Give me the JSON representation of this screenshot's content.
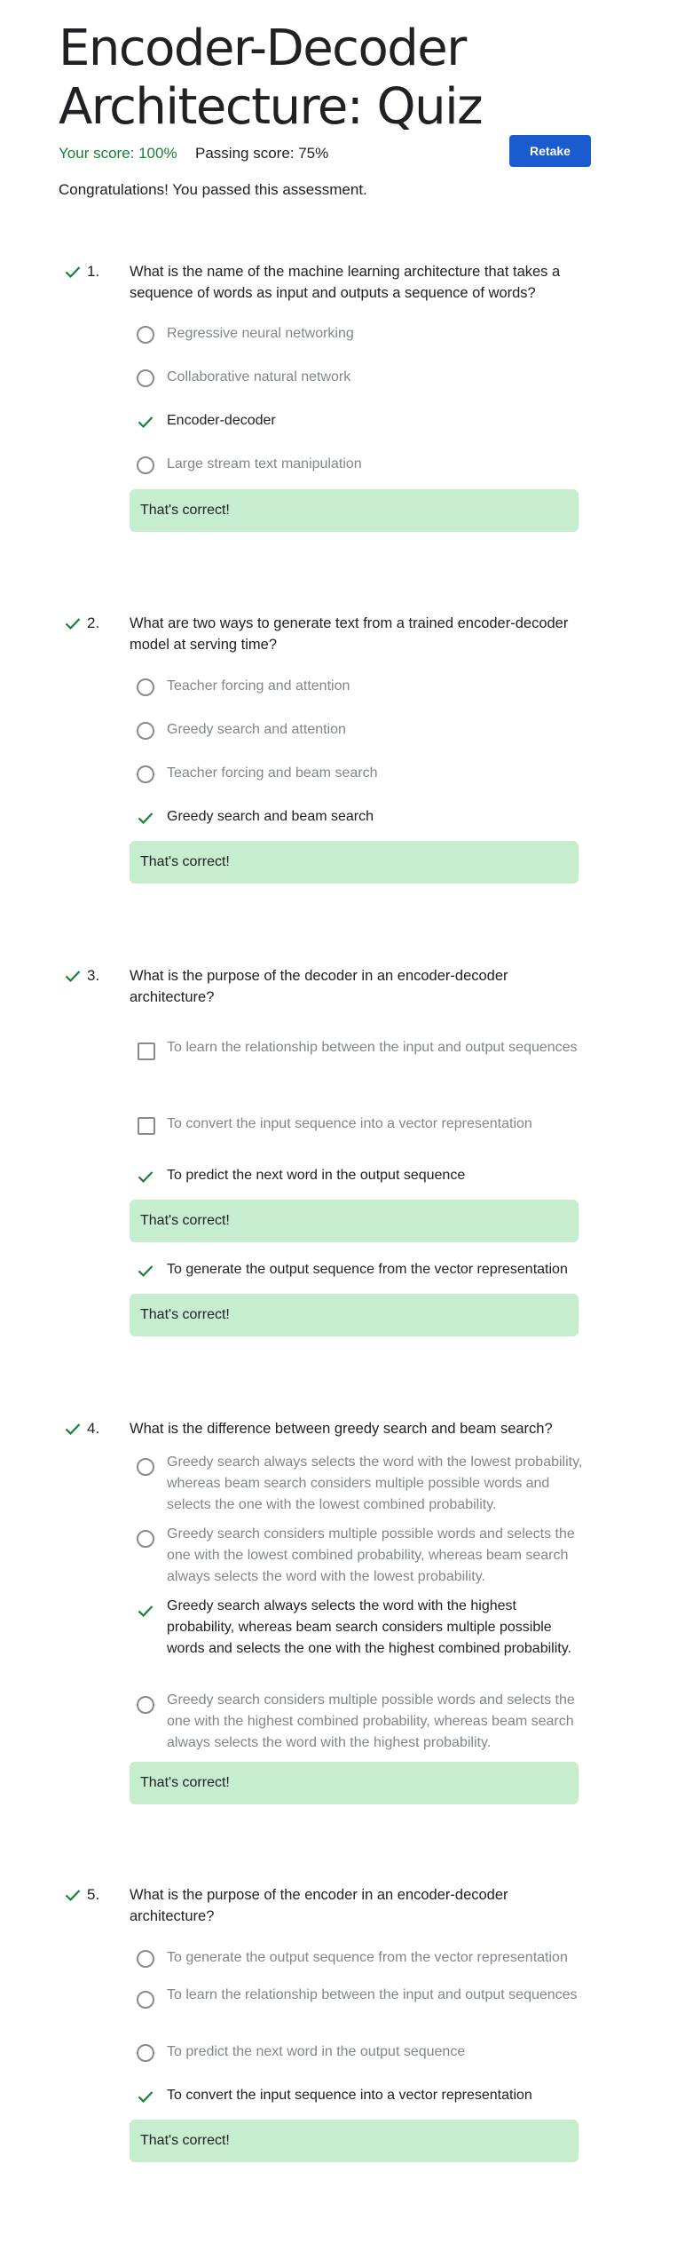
{
  "page": {
    "title_line1": "Encoder-Decoder",
    "title_line2": "Architecture: Quiz",
    "score_label": "Your score: 100%",
    "passing_label": "Passing score: 75%",
    "retake_label": "Retake",
    "congrats": "Congratulations! You passed this assessment."
  },
  "colors": {
    "accent_button": "#1a5cd0",
    "correct_green": "#188038",
    "feedback_bg": "#c7edcf"
  },
  "questions": [
    {
      "number": "1.",
      "text": "What is the name of the machine learning architecture that takes a sequence of words as input and outputs a sequence of words?",
      "options": [
        {
          "label": "Regressive neural networking",
          "mark": "radio"
        },
        {
          "label": "Collaborative natural network",
          "mark": "radio"
        },
        {
          "label": "Encoder-decoder",
          "mark": "check"
        },
        {
          "label": "Large stream text manipulation",
          "mark": "radio"
        }
      ],
      "feedback": [
        "That's correct!"
      ]
    },
    {
      "number": "2.",
      "text": "What are two ways to generate text from a trained encoder-decoder model at serving time?",
      "options": [
        {
          "label": "Teacher forcing and attention",
          "mark": "radio"
        },
        {
          "label": "Greedy search and attention",
          "mark": "radio"
        },
        {
          "label": "Teacher forcing and beam search",
          "mark": "radio"
        },
        {
          "label": "Greedy search and beam search",
          "mark": "check"
        }
      ],
      "feedback": [
        "That's correct!"
      ]
    },
    {
      "number": "3.",
      "text": "What is the purpose of the decoder in an encoder-decoder architecture?",
      "options": [
        {
          "label": "To learn the relationship between the input and output sequences",
          "mark": "checkbox"
        },
        {
          "label": "To convert the input sequence into a vector representation",
          "mark": "checkbox"
        },
        {
          "label": "To predict the next word in the output sequence",
          "mark": "check"
        },
        {
          "label": "To generate the output sequence from the vector representation",
          "mark": "check"
        }
      ],
      "feedback": [
        "That's correct!",
        "That's correct!"
      ]
    },
    {
      "number": "4.",
      "text": "What is the difference between greedy search and beam search?",
      "options": [
        {
          "label": "Greedy search always selects the word with the lowest probability, whereas beam search considers multiple possible words and selects the one with the lowest combined probability.",
          "mark": "radio"
        },
        {
          "label": "Greedy search considers multiple possible words and selects the one with the lowest combined probability, whereas beam search always selects the word with the lowest probability.",
          "mark": "radio"
        },
        {
          "label": "Greedy search always selects the word with the highest probability, whereas beam search considers multiple possible words and selects the one with the highest combined probability.",
          "mark": "check"
        },
        {
          "label": "Greedy search considers multiple possible words and selects the one with the highest combined probability, whereas beam search always selects the word with the highest probability.",
          "mark": "radio"
        }
      ],
      "feedback": [
        "That's correct!"
      ]
    },
    {
      "number": "5.",
      "text": "What is the purpose of the encoder in an encoder-decoder architecture?",
      "options": [
        {
          "label": "To generate the output sequence from the vector representation",
          "mark": "radio"
        },
        {
          "label": "To learn the relationship between the input and output sequences",
          "mark": "radio"
        },
        {
          "label": "To predict the next word in the output sequence",
          "mark": "radio"
        },
        {
          "label": "To convert the input sequence into a vector representation",
          "mark": "check"
        }
      ],
      "feedback": [
        "That's correct!"
      ]
    }
  ]
}
